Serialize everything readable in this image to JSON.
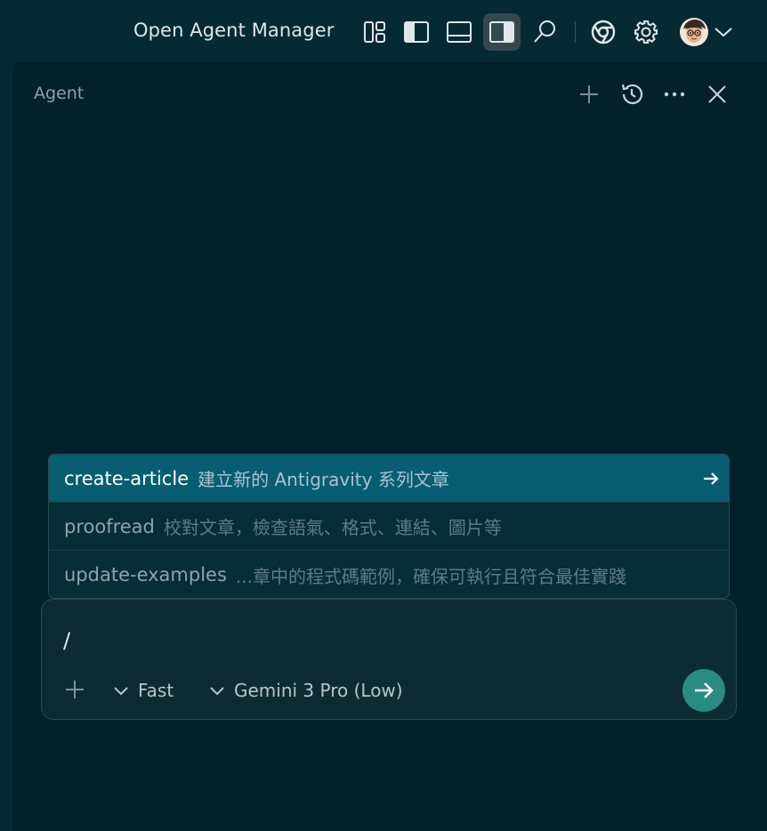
{
  "topbar": {
    "title": "Open Agent Manager",
    "icons": [
      "layout-grid-icon",
      "sidebar-left-icon",
      "panel-bottom-icon",
      "sidebar-right-icon",
      "search-icon",
      "chrome-icon",
      "gear-icon",
      "avatar",
      "chevron-down-icon"
    ],
    "active_toggle": "sidebar-right-icon"
  },
  "panel": {
    "title": "Agent",
    "actions": [
      "plus-icon",
      "history-icon",
      "more-icon",
      "close-icon"
    ]
  },
  "suggestions": [
    {
      "name": "create-article",
      "description": "建立新的 Antigravity 系列文章",
      "selected": true
    },
    {
      "name": "proofread",
      "description": "校對文章，檢查語氣、格式、連結、圖片等",
      "selected": false
    },
    {
      "name": "update-examples",
      "description": "...章中的程式碼範例，確保可執行且符合最佳實踐",
      "selected": false
    }
  ],
  "composer": {
    "input_value": "/",
    "mode": "Fast",
    "model": "Gemini 3 Pro (Low)"
  },
  "colors": {
    "background": "#062a33",
    "panel": "#03212a",
    "selected_row": "#075d72",
    "send_button": "#2a8b83"
  }
}
